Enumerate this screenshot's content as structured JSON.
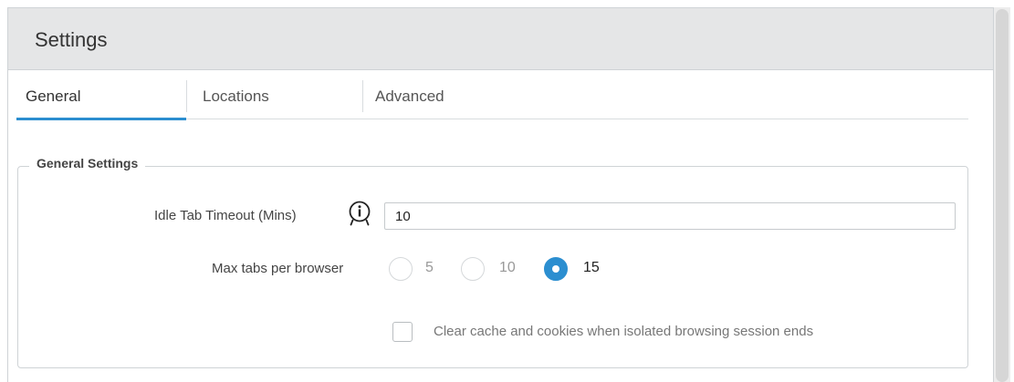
{
  "header": {
    "title": "Settings"
  },
  "tabs": [
    {
      "label": "General",
      "active": true
    },
    {
      "label": "Locations",
      "active": false
    },
    {
      "label": "Advanced",
      "active": false
    }
  ],
  "general_settings": {
    "legend": "General Settings",
    "idle_tab_timeout": {
      "label": "Idle Tab Timeout (Mins)",
      "value": "10",
      "icon": "info-icon"
    },
    "max_tabs": {
      "label": "Max tabs per browser",
      "options": [
        "5",
        "10",
        "15"
      ],
      "selected": "15"
    },
    "clear_cache": {
      "label": "Clear cache and cookies when isolated browsing session ends",
      "checked": false
    }
  },
  "colors": {
    "accent": "#2b8ed0",
    "header_bg": "#e5e6e7"
  }
}
